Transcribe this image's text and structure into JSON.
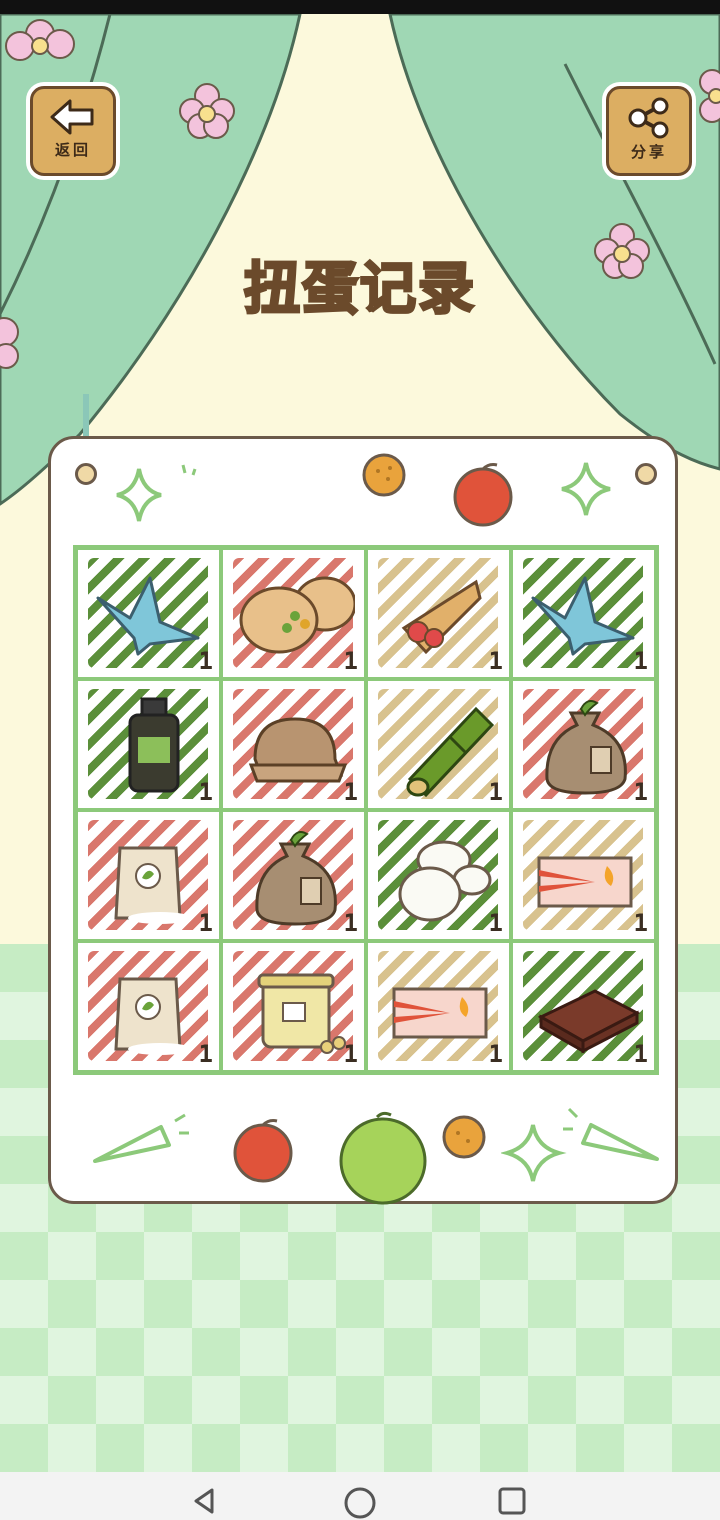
{
  "screen": {
    "title": "扭蛋记录"
  },
  "buttons": {
    "back_label": "返回",
    "share_label": "分享"
  },
  "grid": {
    "cells": [
      {
        "item": "paper-crane-icon",
        "count": "1",
        "bg": "green"
      },
      {
        "item": "pita-sandwich-icon",
        "count": "1",
        "bg": "red"
      },
      {
        "item": "crepe-cone-icon",
        "count": "1",
        "bg": "tan"
      },
      {
        "item": "paper-crane-icon",
        "count": "1",
        "bg": "green"
      },
      {
        "item": "bottle-icon",
        "count": "1",
        "bg": "green"
      },
      {
        "item": "bread-slices-icon",
        "count": "1",
        "bg": "red"
      },
      {
        "item": "bamboo-icon",
        "count": "1",
        "bg": "tan"
      },
      {
        "item": "seed-sack-icon",
        "count": "1",
        "bg": "red"
      },
      {
        "item": "flour-bag-icon",
        "count": "1",
        "bg": "red"
      },
      {
        "item": "seed-sack-icon",
        "count": "1",
        "bg": "red"
      },
      {
        "item": "rice-cakes-icon",
        "count": "1",
        "bg": "green"
      },
      {
        "item": "flag-ticket-icon",
        "count": "1",
        "bg": "tan"
      },
      {
        "item": "flour-bag-icon",
        "count": "1",
        "bg": "red"
      },
      {
        "item": "jar-icon",
        "count": "1",
        "bg": "red"
      },
      {
        "item": "flag-ticket-icon",
        "count": "1",
        "bg": "tan"
      },
      {
        "item": "chocolate-icon",
        "count": "1",
        "bg": "green"
      }
    ]
  }
}
